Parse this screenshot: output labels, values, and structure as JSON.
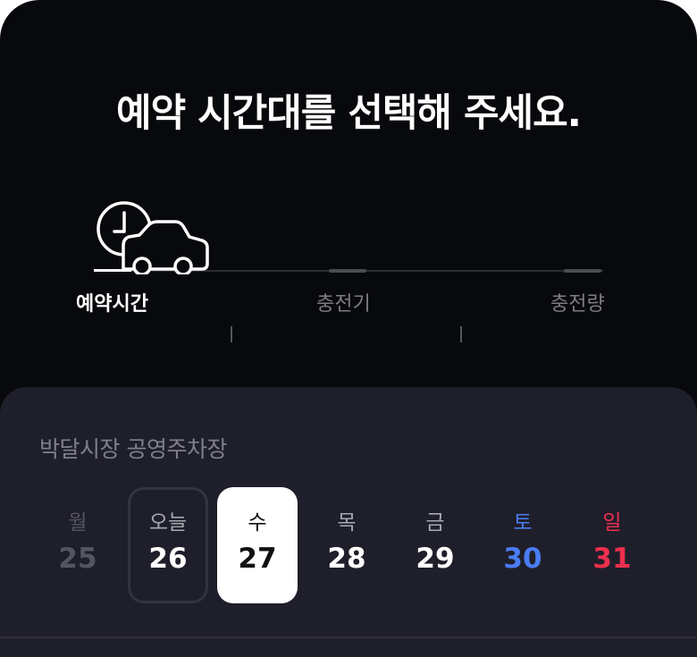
{
  "header": {
    "title": "예약 시간대를 선택해 주세요."
  },
  "stepper": {
    "steps": [
      {
        "label": "예약시간",
        "active": true
      },
      {
        "label": "충전기",
        "active": false
      },
      {
        "label": "충전량",
        "active": false
      }
    ],
    "icon": "clock-car-icon"
  },
  "sheet": {
    "lot_name": "박달시장 공영주차장",
    "days": [
      {
        "name": "월",
        "num": "25",
        "state": "past"
      },
      {
        "name": "오늘",
        "num": "26",
        "state": "today"
      },
      {
        "name": "수",
        "num": "27",
        "state": "selected"
      },
      {
        "name": "목",
        "num": "28",
        "state": "normal"
      },
      {
        "name": "금",
        "num": "29",
        "state": "normal"
      },
      {
        "name": "토",
        "num": "30",
        "state": "saturday"
      },
      {
        "name": "일",
        "num": "31",
        "state": "sunday"
      }
    ]
  },
  "colors": {
    "background": "#08090c",
    "sheet": "#1f1f2b",
    "saturday": "#4a7cf3",
    "sunday": "#ee2f4e",
    "past": "#54555f",
    "muted": "#7f808a"
  }
}
